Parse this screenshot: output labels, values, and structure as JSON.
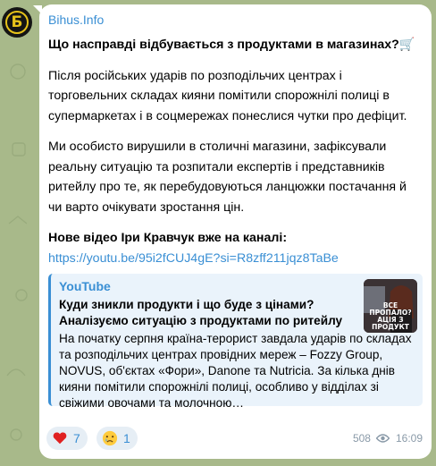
{
  "channel": {
    "name": "Bihus.Info",
    "avatar_letter": "Б"
  },
  "message": {
    "headline": "Що насправді відбувається з продуктами в магазинах?",
    "headline_emoji": "🛒",
    "paragraph1": "Після російських ударів по розподільчих центрах і торговельних складах кияни помітили спорожнілі полиці в супермаркетах і в соцмережах понеслися чутки про дефіцит.",
    "paragraph2": "Ми особисто вирушили в столичні магазини, зафіксували реальну ситуацію та розпитали експертів і представників ритейлу про те, як перебудовуються ланцюжки постачання й чи варто очікувати зростання цін.",
    "new_video": "Нове відео Іри Кравчук вже на каналі:",
    "link": "https://youtu.be/95i2fCUJ4gE?si=R8zff211jqz8TaBe"
  },
  "preview": {
    "site": "YouTube",
    "title": "Куди зникли продукти і що буде з цінами? Аналізуємо ситуацію з продуктами по ритейлу",
    "description": "На початку серпня країна-терорист завдала ударів по складах та розподільчих центрах провідних мереж – Fozzy Group, NOVUS, об'єктах «Фори», Danone та Nutricia. За кілька днів кияни помітили спорожнілі полиці, особливо у відділах зі свіжими овочами та молочною…",
    "thumbnail_text": "ВСЕ ПРОПАЛО? АЦІЯ З ПРОДУКТ"
  },
  "reactions": [
    {
      "emoji": "heart-icon",
      "count": "7"
    },
    {
      "emoji": "crying-face-icon",
      "count": "1"
    }
  ],
  "meta": {
    "views": "508",
    "time": "16:09"
  },
  "colors": {
    "accent": "#3a8fd4",
    "wallpaper": "#a8b98a",
    "bubble": "#ffffff"
  }
}
